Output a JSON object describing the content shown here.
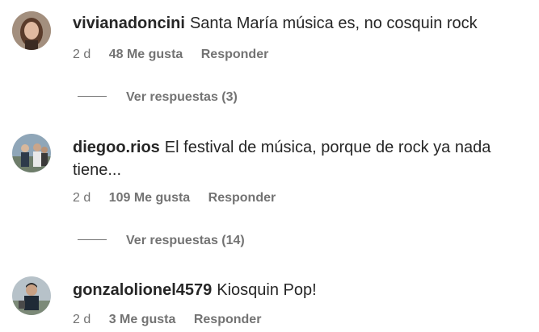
{
  "comments": [
    {
      "username": "vivianadoncini",
      "text": "Santa María música es, no cosquin rock",
      "time": "2 d",
      "likes": "48 Me gusta",
      "reply_label": "Responder",
      "view_replies": "Ver respuestas (3)",
      "avatar_icon": "profile-photo-woman"
    },
    {
      "username": "diegoo.rios",
      "text": "El festival de música, porque de rock ya nada tiene...",
      "time": "2 d",
      "likes": "109 Me gusta",
      "reply_label": "Responder",
      "view_replies": "Ver respuestas (14)",
      "avatar_icon": "profile-photo-group"
    },
    {
      "username": "gonzalolionel4579",
      "text": "Kiosquin Pop!",
      "time": "2 d",
      "likes": "3 Me gusta",
      "reply_label": "Responder",
      "avatar_icon": "profile-photo-man"
    }
  ]
}
